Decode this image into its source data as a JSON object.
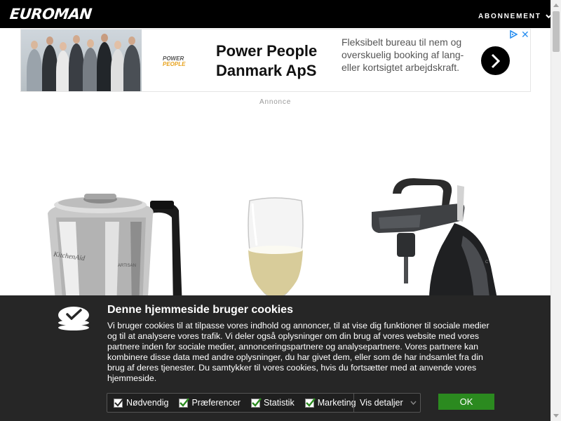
{
  "header": {
    "logo": "EUROMAN",
    "subscription_label": "ABONNEMENT"
  },
  "ad": {
    "brand_logo_text": "POWER",
    "brand_logo_text2": "PEOPLE",
    "headline": "Power People Danmark ApS",
    "body": "Fleksibelt bureau til nem og overskuelig booking af lang- eller kortsigtet arbejdskraft.",
    "label": "Annonce",
    "accent_color": "#2a8ff0"
  },
  "products": [
    {
      "name": "kettle",
      "brand_text": "KitchenAid",
      "model_text": "ARTISAN"
    },
    {
      "name": "champagne-glass"
    },
    {
      "name": "wine-dispenser"
    }
  ],
  "cookie": {
    "title": "Denne hjemmeside bruger cookies",
    "text": "Vi bruger cookies til at tilpasse vores indhold og annoncer, til at vise dig funktioner til sociale medier og til at analysere vores trafik. Vi deler også oplysninger om din brug af vores website med vores partnere inden for sociale medier, annonceringspartnere og analysepartnere. Vores partnere kan kombinere disse data med andre oplysninger, du har givet dem, eller som de har indsamlet fra din brug af deres tjenester. Du samtykker til vores cookies, hvis du fortsætter med at anvende vores hjemmeside.",
    "checkboxes": [
      {
        "label": "Nødvendig",
        "checked": true
      },
      {
        "label": "Præferencer",
        "checked": true
      },
      {
        "label": "Statistik",
        "checked": true
      },
      {
        "label": "Marketing",
        "checked": true
      }
    ],
    "details_label": "Vis detaljer",
    "ok_label": "OK",
    "ok_color": "#2b8a1f"
  }
}
